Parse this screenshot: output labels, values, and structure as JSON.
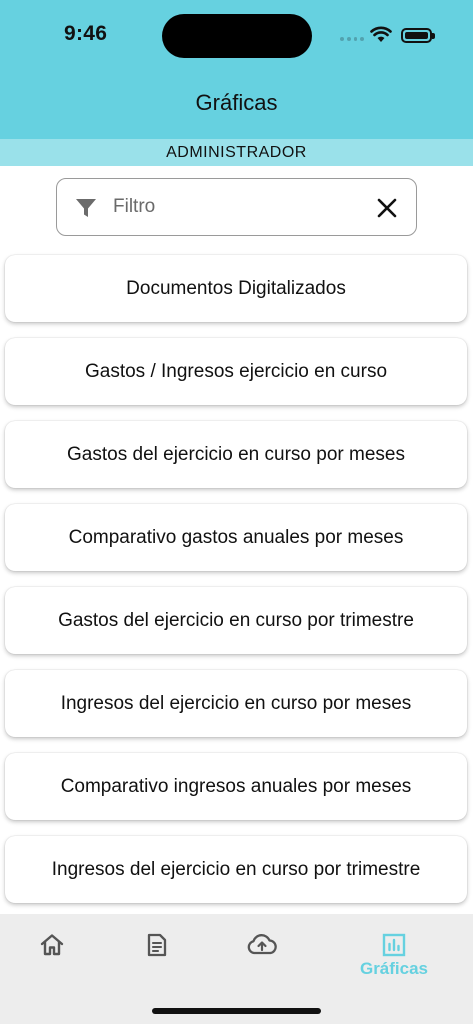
{
  "status": {
    "time": "9:46"
  },
  "header": {
    "title": "Gráficas"
  },
  "role": {
    "label": "ADMINISTRADOR"
  },
  "filter": {
    "placeholder": "Filtro",
    "value": ""
  },
  "items": [
    {
      "label": "Documentos Digitalizados"
    },
    {
      "label": "Gastos / Ingresos ejercicio en curso"
    },
    {
      "label": "Gastos del ejercicio en curso por meses"
    },
    {
      "label": "Comparativo gastos anuales por meses"
    },
    {
      "label": "Gastos del ejercicio en curso por trimestre"
    },
    {
      "label": "Ingresos del ejercicio en curso por meses"
    },
    {
      "label": "Comparativo ingresos anuales por meses"
    },
    {
      "label": "Ingresos del ejercicio en curso por trimestre"
    }
  ],
  "nav": {
    "items": [
      {
        "icon": "home-icon",
        "label": ""
      },
      {
        "icon": "document-icon",
        "label": ""
      },
      {
        "icon": "cloud-upload-icon",
        "label": ""
      },
      {
        "icon": "bar-chart-icon",
        "label": "Gráficas",
        "active": true
      }
    ]
  },
  "colors": {
    "accent": "#66D1E0",
    "role_bar": "#9AE1EA",
    "nav_bg": "#EDEDED",
    "inactive_icon": "#555555"
  }
}
